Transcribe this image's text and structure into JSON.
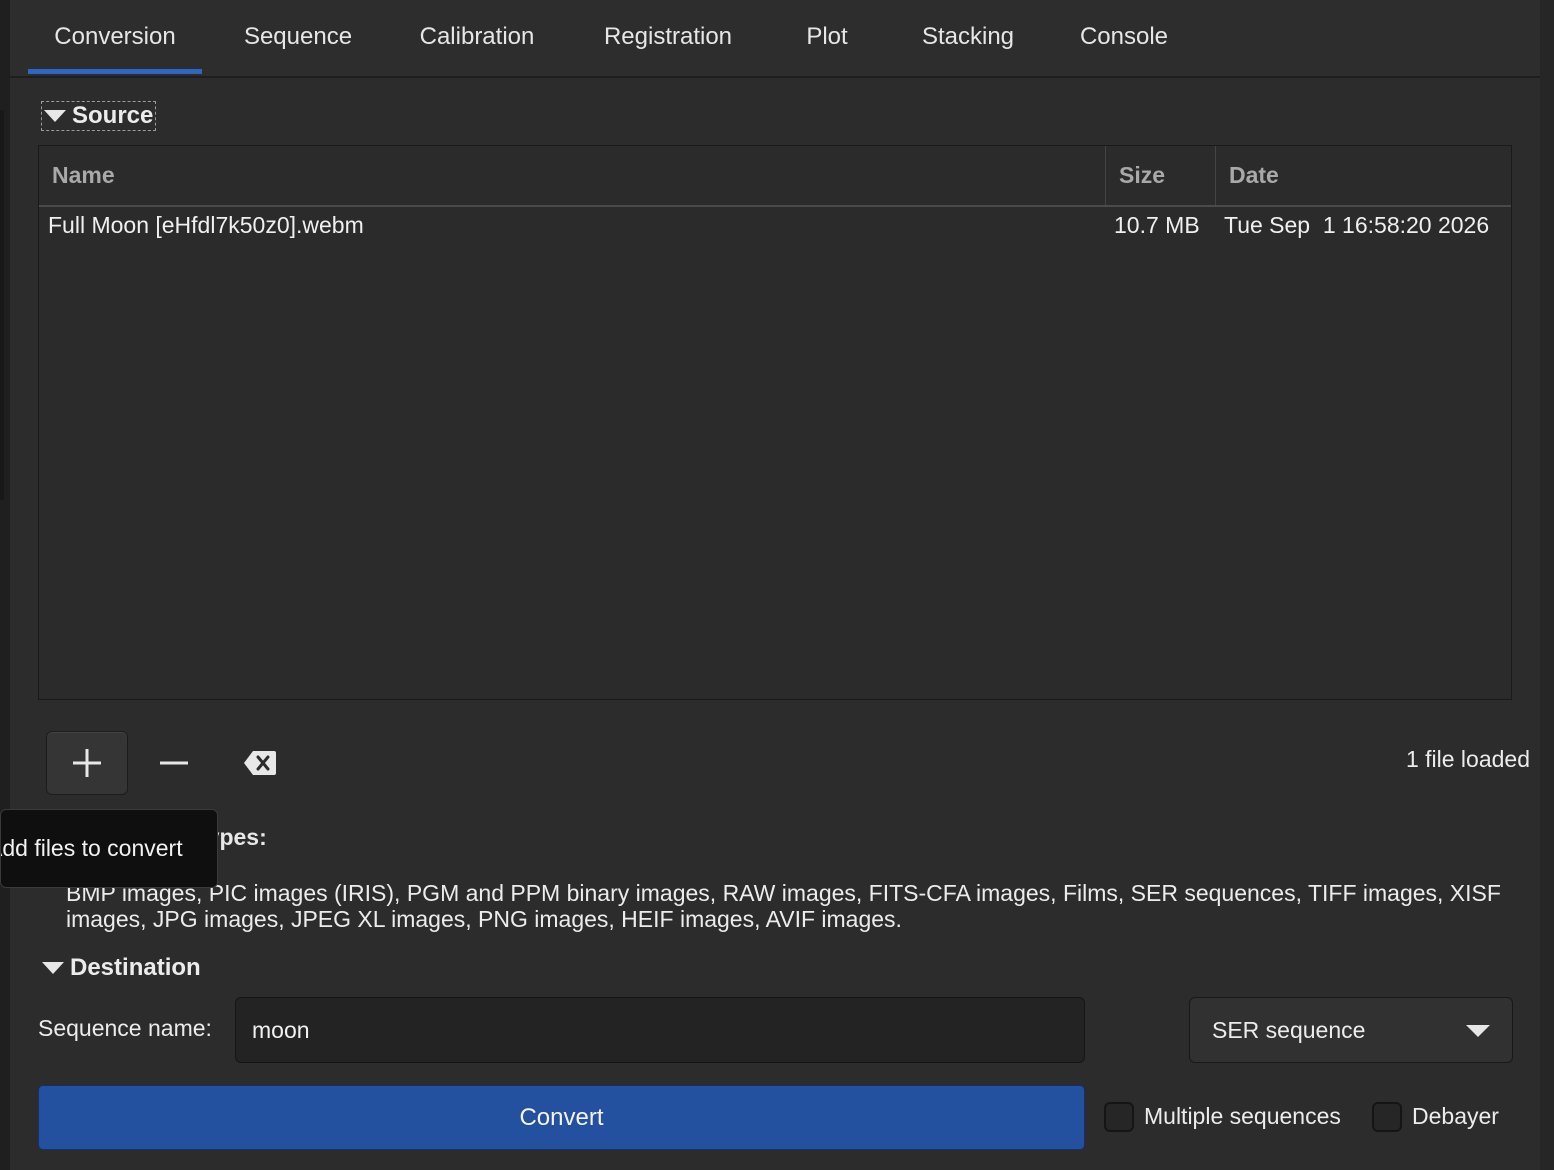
{
  "tabs": [
    {
      "label": "Conversion",
      "active": true
    },
    {
      "label": "Sequence"
    },
    {
      "label": "Calibration"
    },
    {
      "label": "Registration"
    },
    {
      "label": "Plot"
    },
    {
      "label": "Stacking"
    },
    {
      "label": "Console"
    }
  ],
  "source": {
    "title": "Source",
    "columns": {
      "name": "Name",
      "size": "Size",
      "date": "Date"
    },
    "files": [
      {
        "name": "Full Moon [eHfdl7k50z0].webm",
        "size": "10.7 MB",
        "date": "Tue Sep  1 16:58:20 2026"
      }
    ],
    "buttons": {
      "add_icon": "plus-icon",
      "remove_icon": "minus-icon",
      "clear_icon": "clear-backspace-icon"
    },
    "status": "1 file loaded",
    "tooltip": "Add files to convert"
  },
  "supported": {
    "label": "Supported file types:",
    "text": "BMP images, PIC images (IRIS), PGM and PPM binary images, RAW images, FITS-CFA images, Films, SER sequences, TIFF images, XISF images, JPG images, JPEG XL images, PNG images, HEIF images, AVIF images."
  },
  "destination": {
    "title": "Destination",
    "seq_label": "Sequence name:",
    "seq_value": "moon",
    "format": "SER sequence",
    "convert_label": "Convert",
    "multiple_label": "Multiple sequences",
    "debayer_label": "Debayer"
  },
  "colors": {
    "accent": "#2f66c2",
    "convert_button": "#2450a0",
    "background": "#2c2c2c"
  }
}
